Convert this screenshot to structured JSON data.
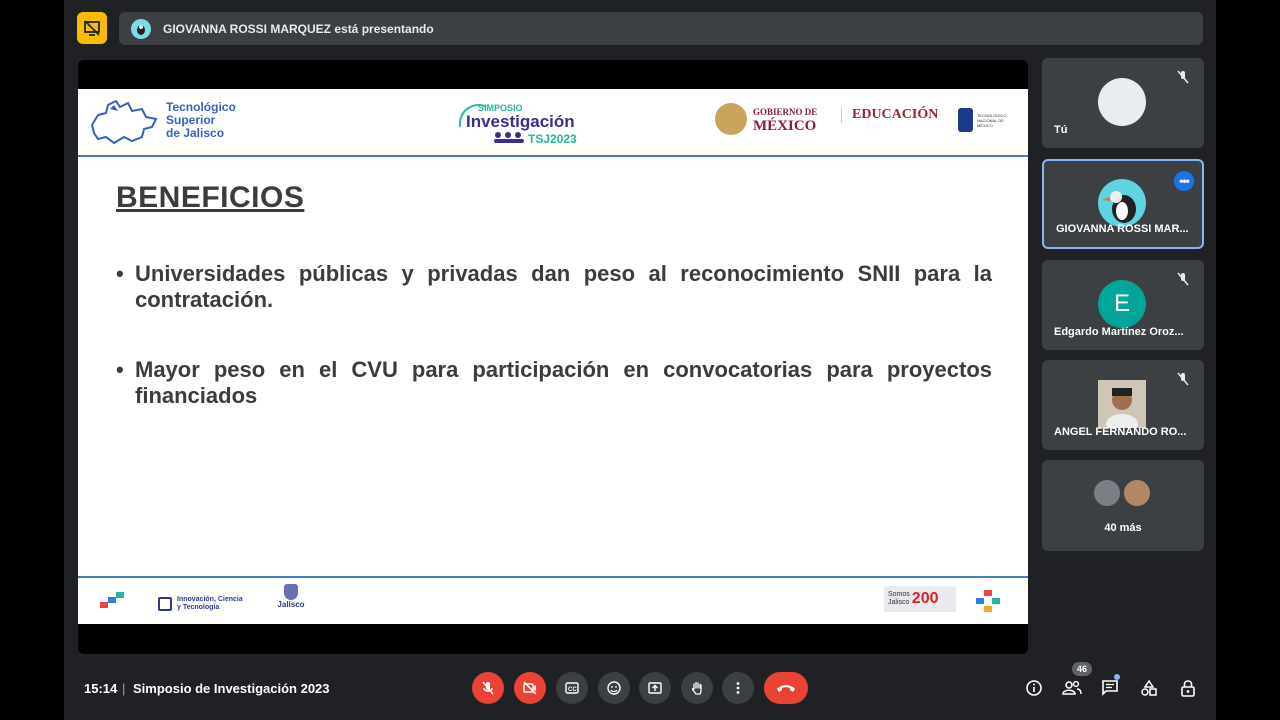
{
  "banner": {
    "text": "GIOVANNA ROSSI MARQUEZ está presentando"
  },
  "slide": {
    "institution": [
      "Tecnológico",
      "Superior",
      "de Jalisco"
    ],
    "symposium_logo": {
      "line1": "SIMPOSIO",
      "line2": "Investigación",
      "line3": "TSJ2023"
    },
    "gob": {
      "line1": "GOBIERNO DE",
      "line2": "MÉXICO"
    },
    "edu": "EDUCACIÓN",
    "tecnm": [
      "TECNOLÓGICO",
      "NACIONAL DE MÉXICO"
    ],
    "title": "BENEFICIOS",
    "bullets": [
      "Universidades públicas y privadas dan peso al reconocimiento SNII para la contratación.",
      "Mayor peso en el CVU para participación en convocatorias para proyectos financiados"
    ],
    "bullet_symbol": "•",
    "footer": {
      "innovacion": [
        "Innovación, Ciencia",
        "y Tecnología"
      ],
      "jalisco": "Jalisco",
      "somos": [
        "Somos",
        "Jalisco"
      ],
      "somos_num": "200"
    }
  },
  "participants": [
    {
      "name": "Tú",
      "muted": true,
      "avatar": "photo",
      "avatar_color": "#e8eef0"
    },
    {
      "name": "GIOVANNA ROSSI MAR...",
      "muted": false,
      "active": true,
      "avatar": "puffin-photo",
      "avatar_color": "#5fd3e0"
    },
    {
      "name": "Edgardo Martínez Oroz...",
      "muted": true,
      "avatar_letter": "E",
      "avatar_color": "#00a699"
    },
    {
      "name": "ANGEL FERNANDO RO...",
      "muted": true,
      "avatar": "photo",
      "avatar_color": "#8a6a52"
    }
  ],
  "more": {
    "label": "40 más"
  },
  "bottom": {
    "time": "15:14",
    "separator": "|",
    "meeting_title": "Simposio de Investigación 2023",
    "people_count": "46"
  },
  "icons": {
    "present": "presentation-off-icon",
    "mic": "mic-off-icon",
    "cam": "camera-off-icon",
    "captions": "captions-icon",
    "emoji": "emoji-icon",
    "present_now": "present-screen-icon",
    "hand": "raise-hand-icon",
    "more": "more-vert-icon",
    "leave": "leave-call-icon",
    "info": "info-icon",
    "people": "people-icon",
    "chat": "chat-icon",
    "activities": "activities-icon",
    "lock": "host-controls-icon"
  },
  "colors": {
    "accent": "#8ab4f8",
    "danger": "#ea4335",
    "present": "#fbbc04",
    "surface": "#3c4043"
  }
}
